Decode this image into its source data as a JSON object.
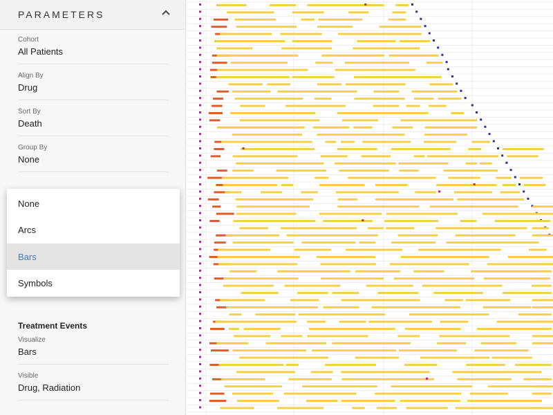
{
  "panel": {
    "title": "PARAMETERS",
    "collapse_icon": "chevron-up-icon",
    "fields": [
      {
        "label": "Cohort",
        "value": "All Patients"
      },
      {
        "label": "Align By",
        "value": "Drug"
      },
      {
        "label": "Sort By",
        "value": "Death"
      },
      {
        "label": "Group By",
        "value": "None"
      }
    ],
    "menu_options": [
      "None",
      "Arcs",
      "Bars",
      "Symbols"
    ],
    "selected_option": "Bars",
    "treatment_section": {
      "title": "Treatment Events",
      "fields": [
        {
          "label": "Visualize",
          "value": "Bars"
        },
        {
          "label": "Visible",
          "value": "Drug, Radiation"
        }
      ]
    }
  },
  "colors": {
    "drug": "#f5cf45",
    "radiation": "#e05a2a",
    "death_marker": "#2b2d8e",
    "align_marker": "#9a2f8e",
    "event_marker": "#d81e5b",
    "highlight_text": "#3a7ebf"
  }
}
